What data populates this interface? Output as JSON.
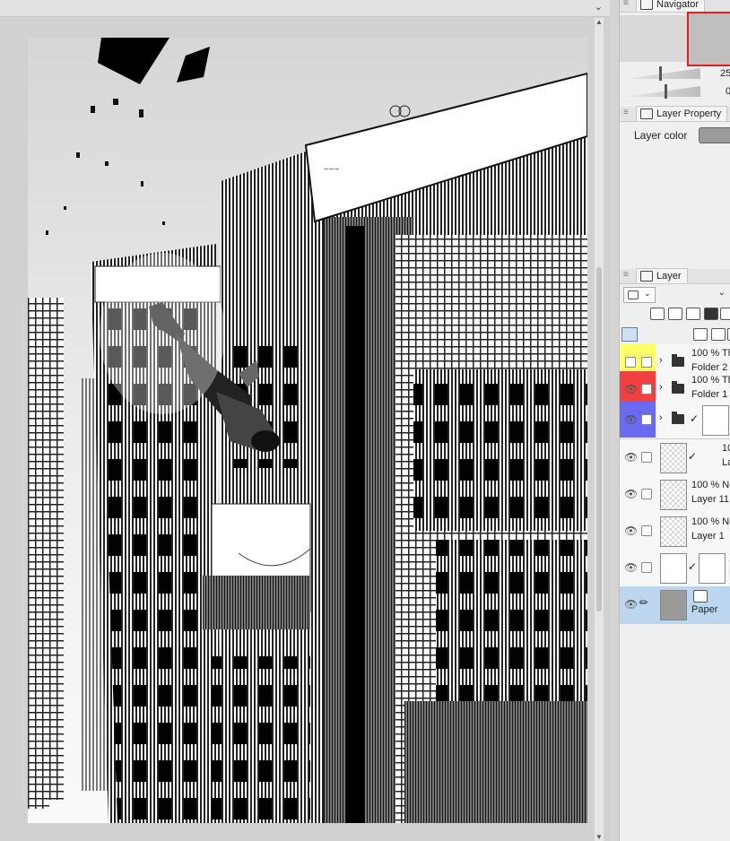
{
  "panels": {
    "navigator": {
      "title": "Navigator",
      "zoom_value": "25",
      "rotate_value": "0"
    },
    "layer_property": {
      "title": "Layer Property",
      "layer_color_label": "Layer color",
      "layer_color": "#9a9a9a"
    },
    "layer": {
      "title": "Layer"
    }
  },
  "layers": [
    {
      "line1": "100 % Th",
      "line2": "Folder 2",
      "color": "#ffff66",
      "kind": "folder",
      "visible": false
    },
    {
      "line1": "100 % Th",
      "line2": "Folder 1",
      "color": "#f04040",
      "kind": "folder",
      "visible": true
    },
    {
      "line1": "",
      "line2": "",
      "color": "#6a6af0",
      "kind": "folder-mask",
      "visible": true
    },
    {
      "line1": "10",
      "line2": "La",
      "color": "",
      "kind": "layer-mask",
      "visible": true
    },
    {
      "line1": "100 % No",
      "line2": "Layer 11",
      "color": "",
      "kind": "layer",
      "visible": true
    },
    {
      "line1": "100 % No",
      "line2": "Layer 1",
      "color": "",
      "kind": "layer",
      "visible": true
    },
    {
      "line1": "1",
      "line2": "F",
      "color": "",
      "kind": "frame",
      "visible": true
    },
    {
      "line1": "",
      "line2": "Paper",
      "color": "",
      "kind": "paper",
      "visible": true
    }
  ],
  "icons": [
    "eye-icon",
    "folder-icon",
    "chevron-down-icon",
    "lock-icon",
    "pencil-icon"
  ]
}
